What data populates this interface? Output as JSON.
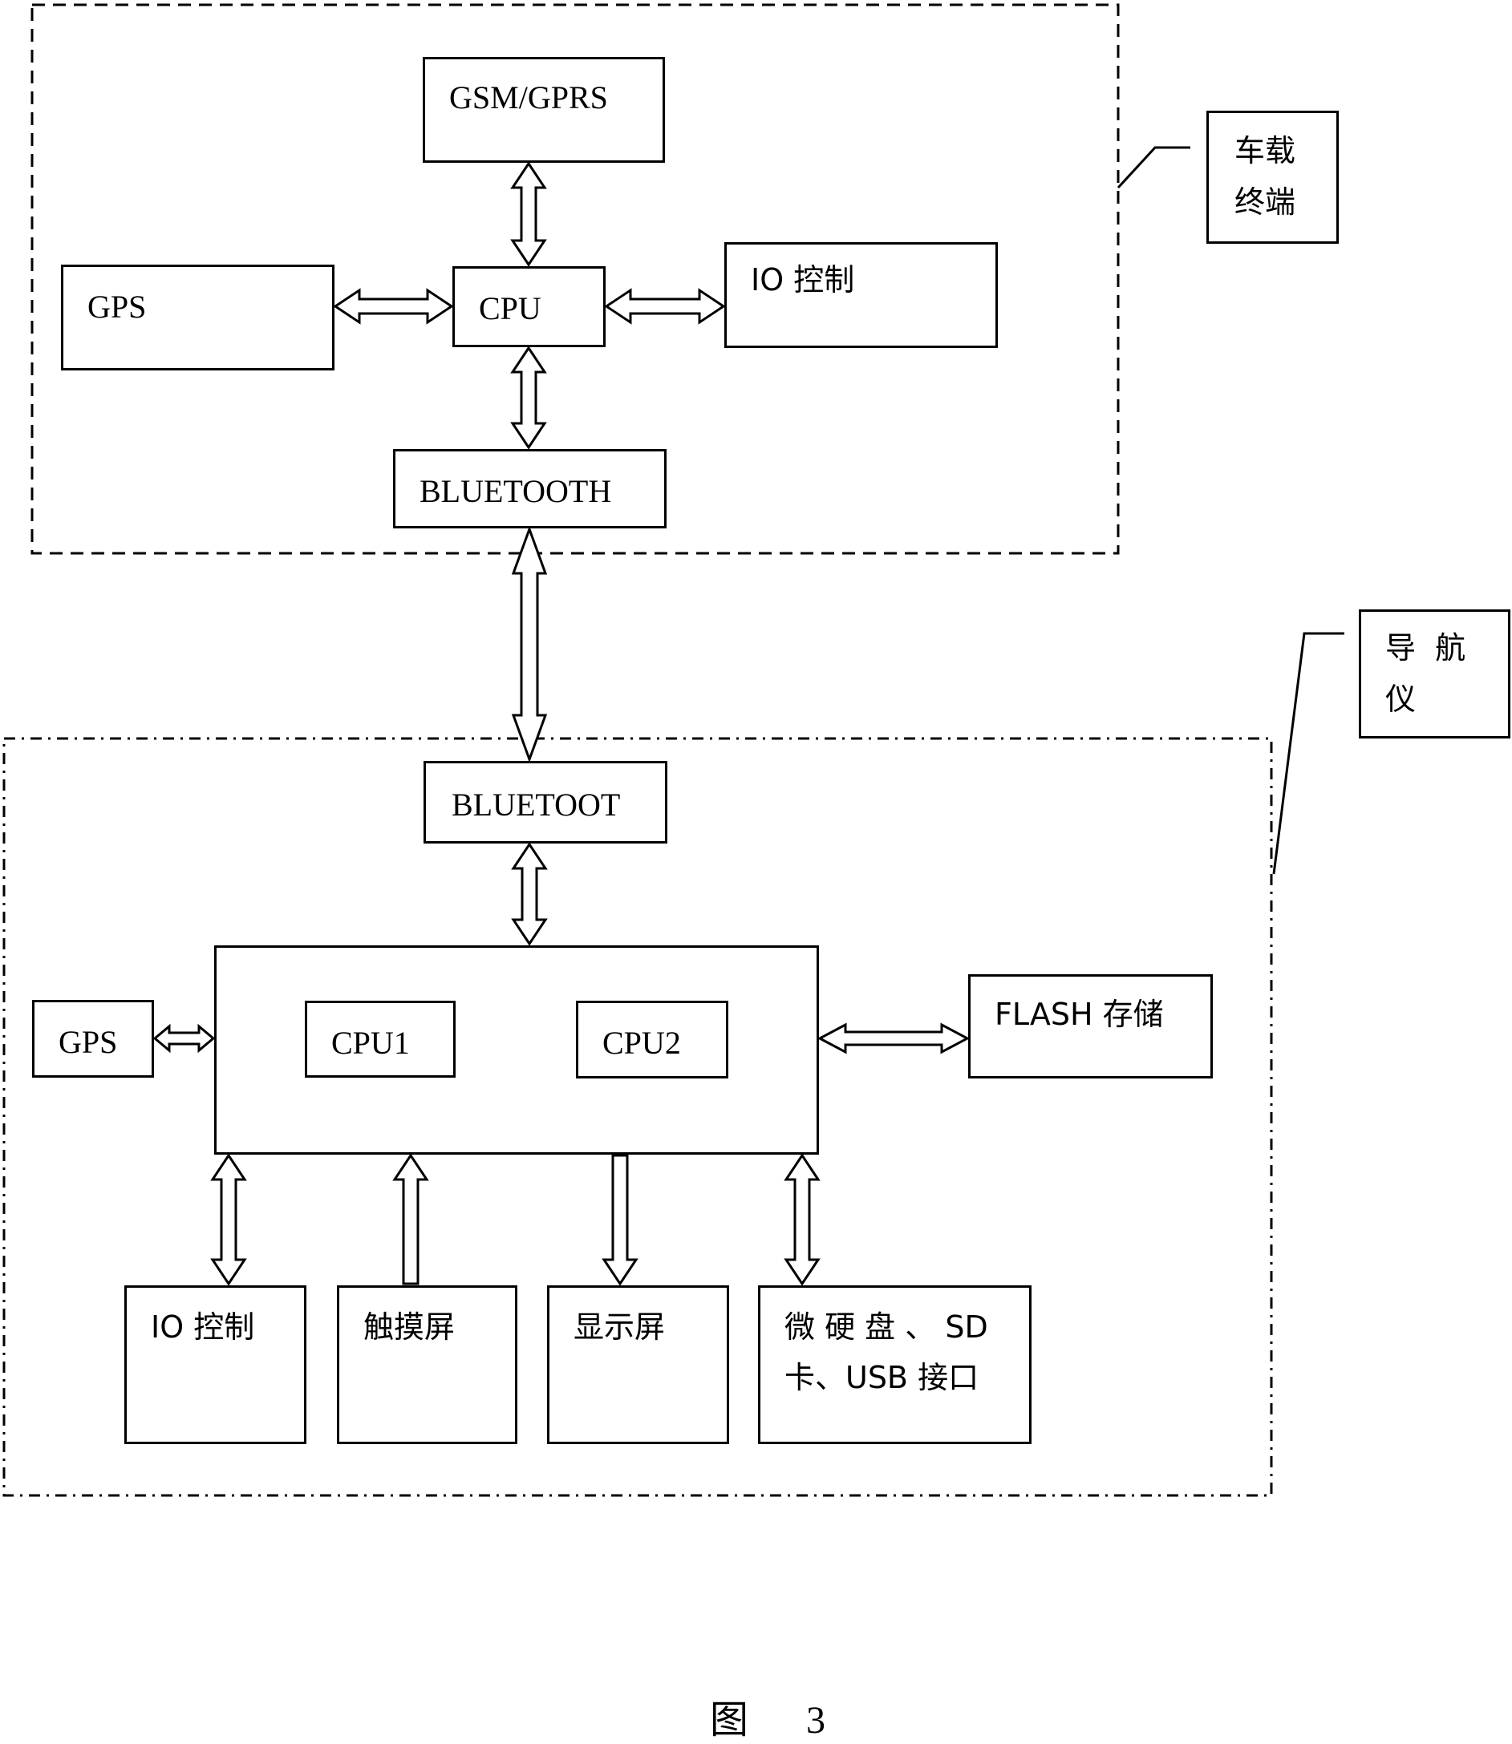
{
  "figure": {
    "caption": "图 3",
    "groups": {
      "vehicle_terminal": {
        "label_line1": "车载",
        "label_line2": "终端",
        "blocks": {
          "gsm": "GSM/GPRS",
          "gps": "GPS",
          "cpu": "CPU",
          "io": "IO 控制",
          "bluetooth": "BLUETOOTH"
        }
      },
      "navigator": {
        "label_line1": "导  航",
        "label_line2": "仪",
        "blocks": {
          "bluetooth": "BLUETOOT",
          "gps": "GPS",
          "cpu1": "CPU1",
          "cpu2": "CPU2",
          "flash": "FLASH 存储",
          "io": "IO 控制",
          "touch": "触摸屏",
          "display": "显示屏",
          "storage_line1": "微 硬 盘 、 SD",
          "storage_line2": "卡、USB 接口"
        }
      }
    },
    "connections": [
      {
        "from": "GSM/GPRS",
        "to": "CPU",
        "type": "bidirectional"
      },
      {
        "from": "GPS",
        "to": "CPU",
        "type": "bidirectional"
      },
      {
        "from": "CPU",
        "to": "IO 控制",
        "type": "bidirectional"
      },
      {
        "from": "CPU",
        "to": "BLUETOOTH",
        "type": "bidirectional"
      },
      {
        "from": "BLUETOOTH",
        "to": "BLUETOOT",
        "type": "bidirectional"
      },
      {
        "from": "BLUETOOT",
        "to": "main-unit",
        "type": "bidirectional"
      },
      {
        "from": "GPS",
        "to": "main-unit",
        "type": "bidirectional"
      },
      {
        "from": "CPU1",
        "to": "CPU2",
        "type": "bidirectional"
      },
      {
        "from": "main-unit",
        "to": "FLASH 存储",
        "type": "bidirectional"
      },
      {
        "from": "main-unit",
        "to": "IO 控制",
        "type": "bidirectional"
      },
      {
        "from": "触摸屏",
        "to": "main-unit",
        "type": "unidirectional"
      },
      {
        "from": "main-unit",
        "to": "显示屏",
        "type": "unidirectional"
      },
      {
        "from": "main-unit",
        "to": "微硬盘、SD卡、USB接口",
        "type": "bidirectional"
      }
    ]
  }
}
